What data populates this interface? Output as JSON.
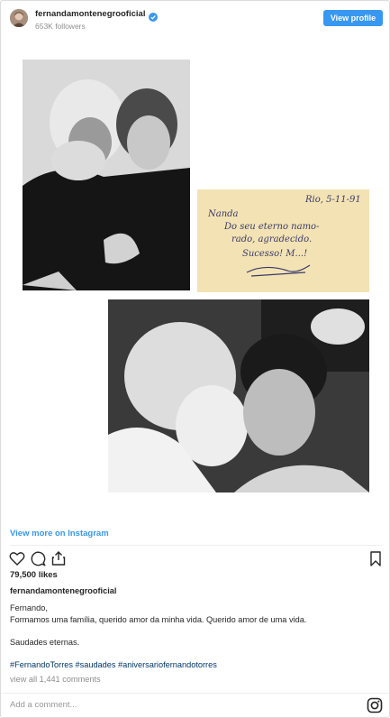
{
  "header": {
    "username": "fernandamontenegrooficial",
    "followers": "653K followers",
    "view_profile_label": "View profile"
  },
  "media": {
    "note_text_lines": [
      "Rio, 5-11-91",
      "Nanda",
      "Do seu eterno namo-",
      "rado, agradecido.",
      "Sucesso! M...!"
    ]
  },
  "view_more_label": "View more on Instagram",
  "actions": {
    "icons": [
      "heart-icon",
      "comment-icon",
      "share-icon",
      "bookmark-icon"
    ]
  },
  "likes": "79,500 likes",
  "caption": {
    "username": "fernandamontenegrooficial",
    "line1": "Fernando,",
    "line2": "Formamos uma família, querido amor da minha vida. Querido amor de uma vida.",
    "line3": "Saudades eternas.",
    "hashtags": "#FernandoTorres #saudades #aniversariofernandotorres",
    "view_all": "view all 1,441 comments"
  },
  "comment_placeholder": "Add a comment...",
  "colors": {
    "accent": "#3897f0",
    "note_paper": "#f3e3b4"
  }
}
